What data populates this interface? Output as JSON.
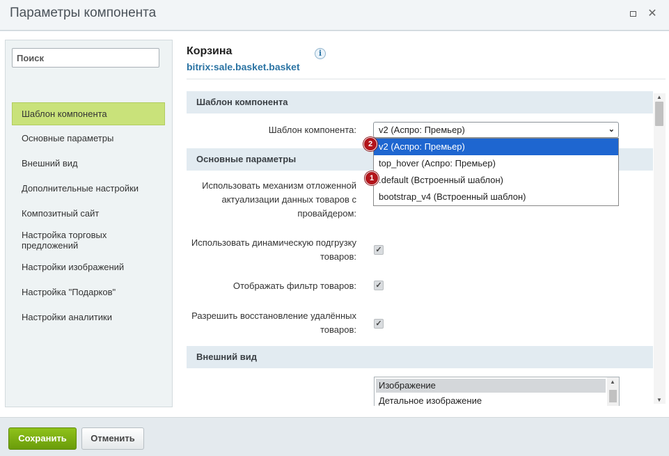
{
  "window": {
    "title": "Параметры компонента"
  },
  "sidebar": {
    "search_placeholder": "Поиск",
    "items": [
      {
        "label": "Шаблон компонента"
      },
      {
        "label": "Основные параметры"
      },
      {
        "label": "Внешний вид"
      },
      {
        "label": "Дополнительные настройки"
      },
      {
        "label": "Композитный сайт"
      },
      {
        "label": "Настройка торговых предложений"
      },
      {
        "label": "Настройки изображений"
      },
      {
        "label": "Настройка \"Подарков\""
      },
      {
        "label": "Настройки аналитики"
      }
    ],
    "active_index": 0
  },
  "component": {
    "name": "Корзина",
    "code": "bitrix:sale.basket.basket",
    "info_icon": "i"
  },
  "sections": {
    "template": "Шаблон компонента",
    "main": "Основные параметры",
    "appearance": "Внешний вид"
  },
  "template_field": {
    "label": "Шаблон компонента:",
    "value": "v2 (Аспро: Премьер)",
    "options": [
      "v2 (Аспро: Премьер)",
      "top_hover (Аспро: Премьер)",
      ".default (Встроенный шаблон)",
      "bootstrap_v4 (Встроенный шаблон)"
    ],
    "selected_option_index": 0
  },
  "badges": {
    "first": "1",
    "second": "2"
  },
  "params": [
    {
      "label": "Использовать механизм отложенной актуализации данных товаров с провайдером:"
    },
    {
      "label": "Использовать динамическую подгрузку товаров:",
      "checked": true
    },
    {
      "label": "Отображать фильтр товаров:",
      "checked": true
    },
    {
      "label": "Разрешить восстановление удалённых товаров:",
      "checked": true
    }
  ],
  "image_list": {
    "items": [
      "Изображение",
      "Детальное изображение"
    ],
    "selected_index": 0
  },
  "footer": {
    "save_label": "Сохранить",
    "cancel_label": "Отменить"
  },
  "colors": {
    "active_nav": "#c9e27a",
    "section_bg": "#e2ebf1",
    "link": "#2a73a3",
    "save_button": "#7aad12",
    "dropdown_selection": "#1e66d0",
    "badge": "#b3151b"
  },
  "icons": {
    "maximize": "maximize-icon",
    "close": "close-icon",
    "info": "info-icon",
    "checkbox": "checkmark-icon",
    "select_arrow": "chevron-down-icon"
  }
}
